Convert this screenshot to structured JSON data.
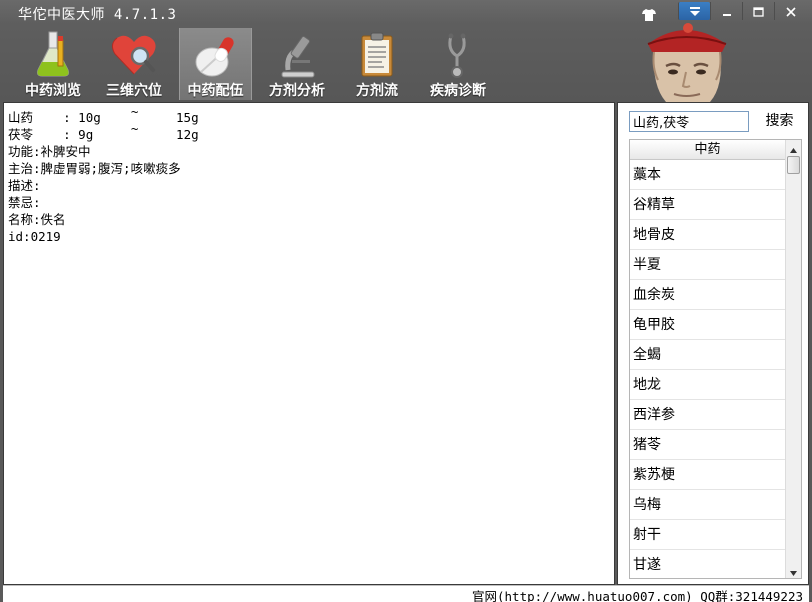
{
  "window": {
    "title": "华佗中医大师 4.7.1.3"
  },
  "toolbar": {
    "items": [
      {
        "label": "中药浏览",
        "icon": "flask-icon"
      },
      {
        "label": "三维穴位",
        "icon": "heart-magnifier-icon"
      },
      {
        "label": "中药配伍",
        "icon": "pill-icon",
        "active": true
      },
      {
        "label": "方剂分析",
        "icon": "microscope-icon"
      },
      {
        "label": "方剂流",
        "icon": "clipboard-icon"
      },
      {
        "label": "疾病诊断",
        "icon": "stethoscope-icon"
      }
    ]
  },
  "content": {
    "lines": [
      {
        "name": "山药",
        "colon": "    : 10g",
        "sep": "~",
        "max": "15g"
      },
      {
        "name": "茯苓",
        "colon": "    : 9g",
        "sep": "~",
        "max": "12g"
      }
    ],
    "function_label": "功能:补脾安中",
    "indication_label": "主治:脾虚胃弱;腹泻;咳嗽痰多",
    "description_label": "描述:",
    "contraindication_label": "禁忌:",
    "name_label": "名称:佚名",
    "id_label": "id:0219"
  },
  "search": {
    "value": "山药,茯苓",
    "button_label": "搜索"
  },
  "herb_list": {
    "header": "中药",
    "items": [
      "藁本",
      "谷精草",
      "地骨皮",
      "半夏",
      "血余炭",
      "龟甲胶",
      "全蝎",
      "地龙",
      "西洋参",
      "猪苓",
      "紫苏梗",
      "乌梅",
      "射干",
      "甘遂"
    ]
  },
  "status": {
    "text": "官网(http://www.huatuo007.com) QQ群:321449223"
  },
  "colors": {
    "background": "#5a5a5a",
    "active_tab": "#7f7f7f",
    "menu_button": "#2f6fb3"
  }
}
